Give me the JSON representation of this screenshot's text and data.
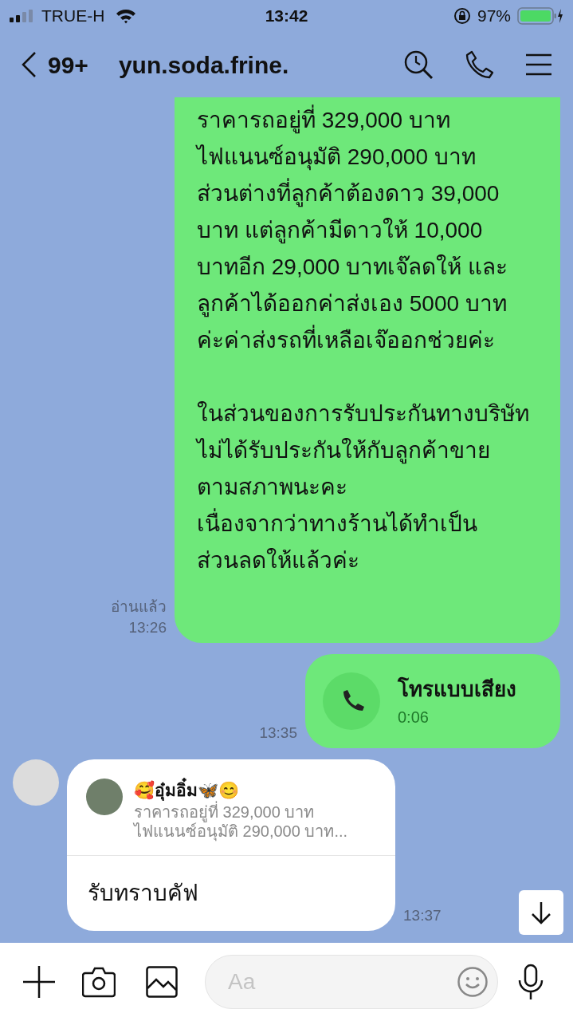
{
  "status_bar": {
    "carrier": "TRUE-H",
    "time": "13:42",
    "battery": "97%"
  },
  "header": {
    "back_count": "99+",
    "title": "yun.soda.frine."
  },
  "messages": [
    {
      "kind": "text",
      "outgoing": true,
      "text": "ราคารถอยู่ที่ 329,000 บาท\nไฟแนนซ์อนุมัติ 290,000 บาท\nส่วนต่างที่ลูกค้าต้องดาว 39,000\nบาท แต่ลูกค้ามีดาวให้ 10,000\nบาทอีก 29,000 บาทเจ๊ลดให้ และ\nลูกค้าได้ออกค่าส่งเอง 5000 บาท\nค่ะค่าส่งรถที่เหลือเจ๊ออกช่วยค่ะ\n\nในส่วนของการรับประกันทางบริษัท\nไม่ได้รับประกันให้กับลูกค้าขาย\nตามสภาพนะคะ\nเนื่องจากว่าทางร้านได้ทำเป็น\nส่วนลดให้แล้วค่ะ",
      "read": "อ่านแล้ว",
      "time": "13:26"
    },
    {
      "kind": "call",
      "outgoing": true,
      "title": "โทรแบบเสียง",
      "duration": "0:06",
      "time": "13:35"
    },
    {
      "kind": "reply",
      "outgoing": false,
      "quote_name": "🥰อุ๋มอิ๋ม🦋😊",
      "quote_text": "ราคารถอยู่ที่ 329,000 บาท\nไฟแนนซ์อนุมัติ 290,000 บาท...",
      "text": "รับทราบคัฟ",
      "time": "13:37"
    }
  ],
  "composer": {
    "placeholder": "Aa"
  }
}
